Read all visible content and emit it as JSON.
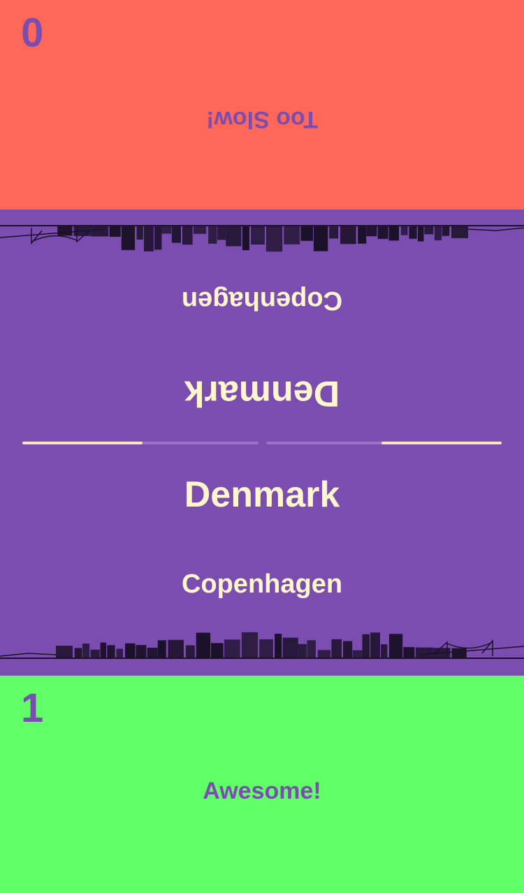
{
  "colors": {
    "top_background": "#FF6759",
    "middle_background": "#7B4DB0",
    "bottom_background": "#61FF68",
    "accent_purple": "#7B4DB0",
    "card_text": "#FFF6CE",
    "progress_fill": "#FFE3C0",
    "progress_track": "#9A73CB",
    "skyline_ink": "#1A1028"
  },
  "opponent": {
    "status": "Too Slow!",
    "score": "0"
  },
  "player": {
    "status": "Awesome!",
    "score": "1"
  },
  "card": {
    "country": "Denmark",
    "capital": "Copenhagen"
  },
  "progress": {
    "left_fraction": 0.51,
    "right_fraction": 0.51
  }
}
